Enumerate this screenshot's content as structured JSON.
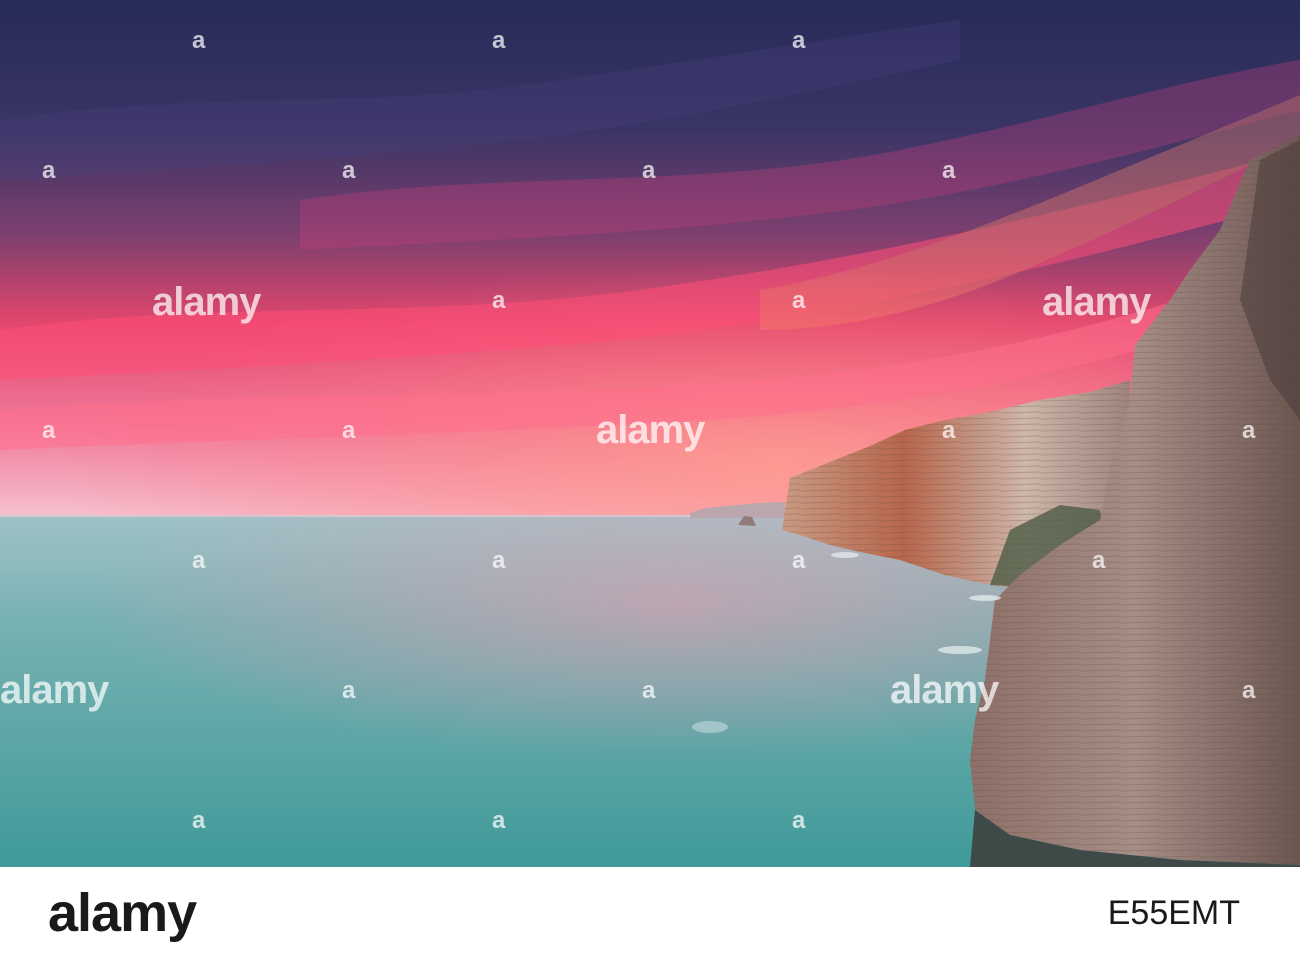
{
  "photo": {
    "subject": "cliffs at sunset over sea",
    "palette": {
      "sky_top": "#2c2f5e",
      "sky_mid": "#e8436a",
      "sky_horizon": "#f4b2c0",
      "sea_far": "#7fb7bd",
      "sea_near": "#4f9ea0",
      "cliff_light": "#c9aa9a",
      "cliff_shadow": "#7a5c55",
      "cliff_orange": "#c8603a"
    }
  },
  "watermark": {
    "word": "alamy",
    "letter": "a"
  },
  "footer": {
    "brand": "alamy",
    "image_id": "E55EMT"
  }
}
